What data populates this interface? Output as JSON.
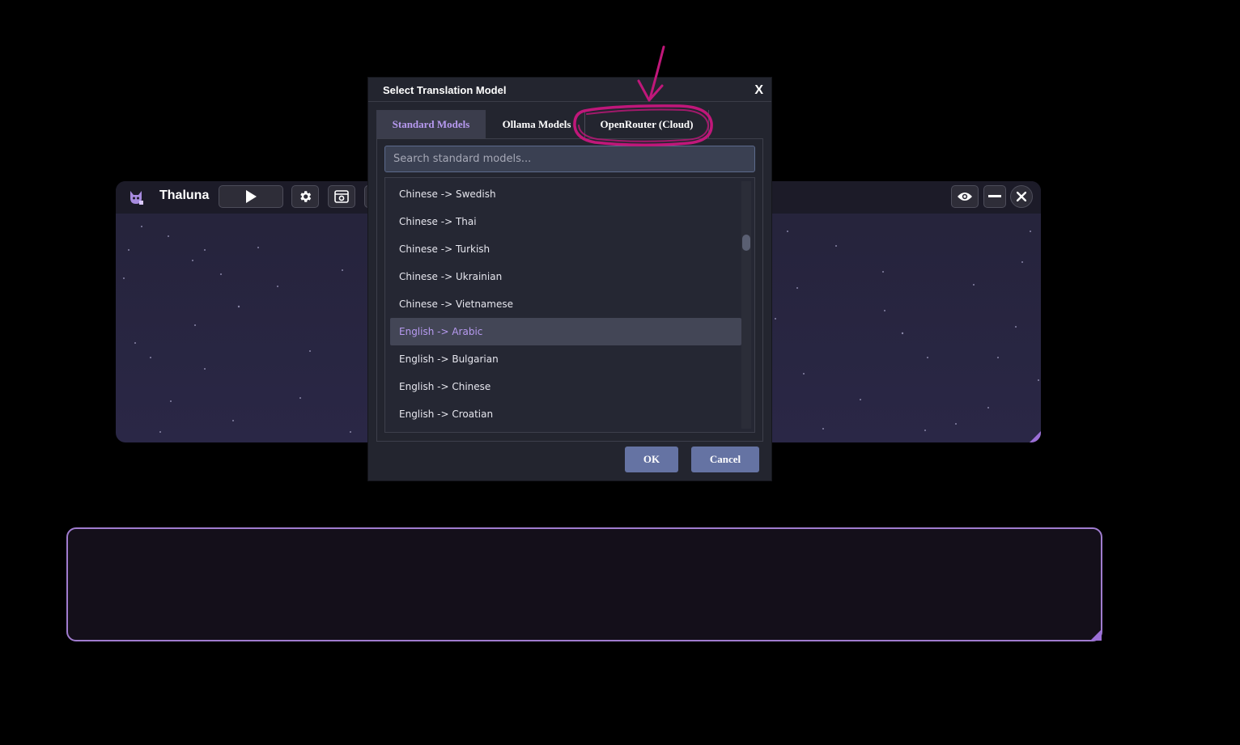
{
  "app": {
    "title": "Thaluna",
    "icons": [
      "cat-logo-icon",
      "play-icon",
      "gear-icon",
      "screenshot-icon",
      "eye-icon",
      "minimize-icon",
      "close-icon"
    ],
    "accent_color": "#9b6fd6"
  },
  "dialog": {
    "title": "Select Translation Model",
    "close_label": "X",
    "tabs": [
      {
        "label": "Standard Models",
        "active": true
      },
      {
        "label": "Ollama Models",
        "active": false
      },
      {
        "label": "OpenRouter (Cloud)",
        "active": false
      }
    ],
    "search": {
      "placeholder": "Search standard models...",
      "value": ""
    },
    "items": [
      {
        "label": "Chinese -> Swedish"
      },
      {
        "label": "Chinese -> Thai"
      },
      {
        "label": "Chinese -> Turkish"
      },
      {
        "label": "Chinese -> Ukrainian"
      },
      {
        "label": "Chinese -> Vietnamese"
      },
      {
        "label": "English -> Arabic",
        "selected": true
      },
      {
        "label": "English -> Bulgarian"
      },
      {
        "label": "English -> Chinese"
      },
      {
        "label": "English -> Croatian"
      }
    ],
    "ok_label": "OK",
    "cancel_label": "Cancel",
    "selected_color": "#b79af0",
    "button_color": "#6573a3"
  },
  "annotation": {
    "color": "#c0177a",
    "highlights": "tab-openrouter"
  }
}
